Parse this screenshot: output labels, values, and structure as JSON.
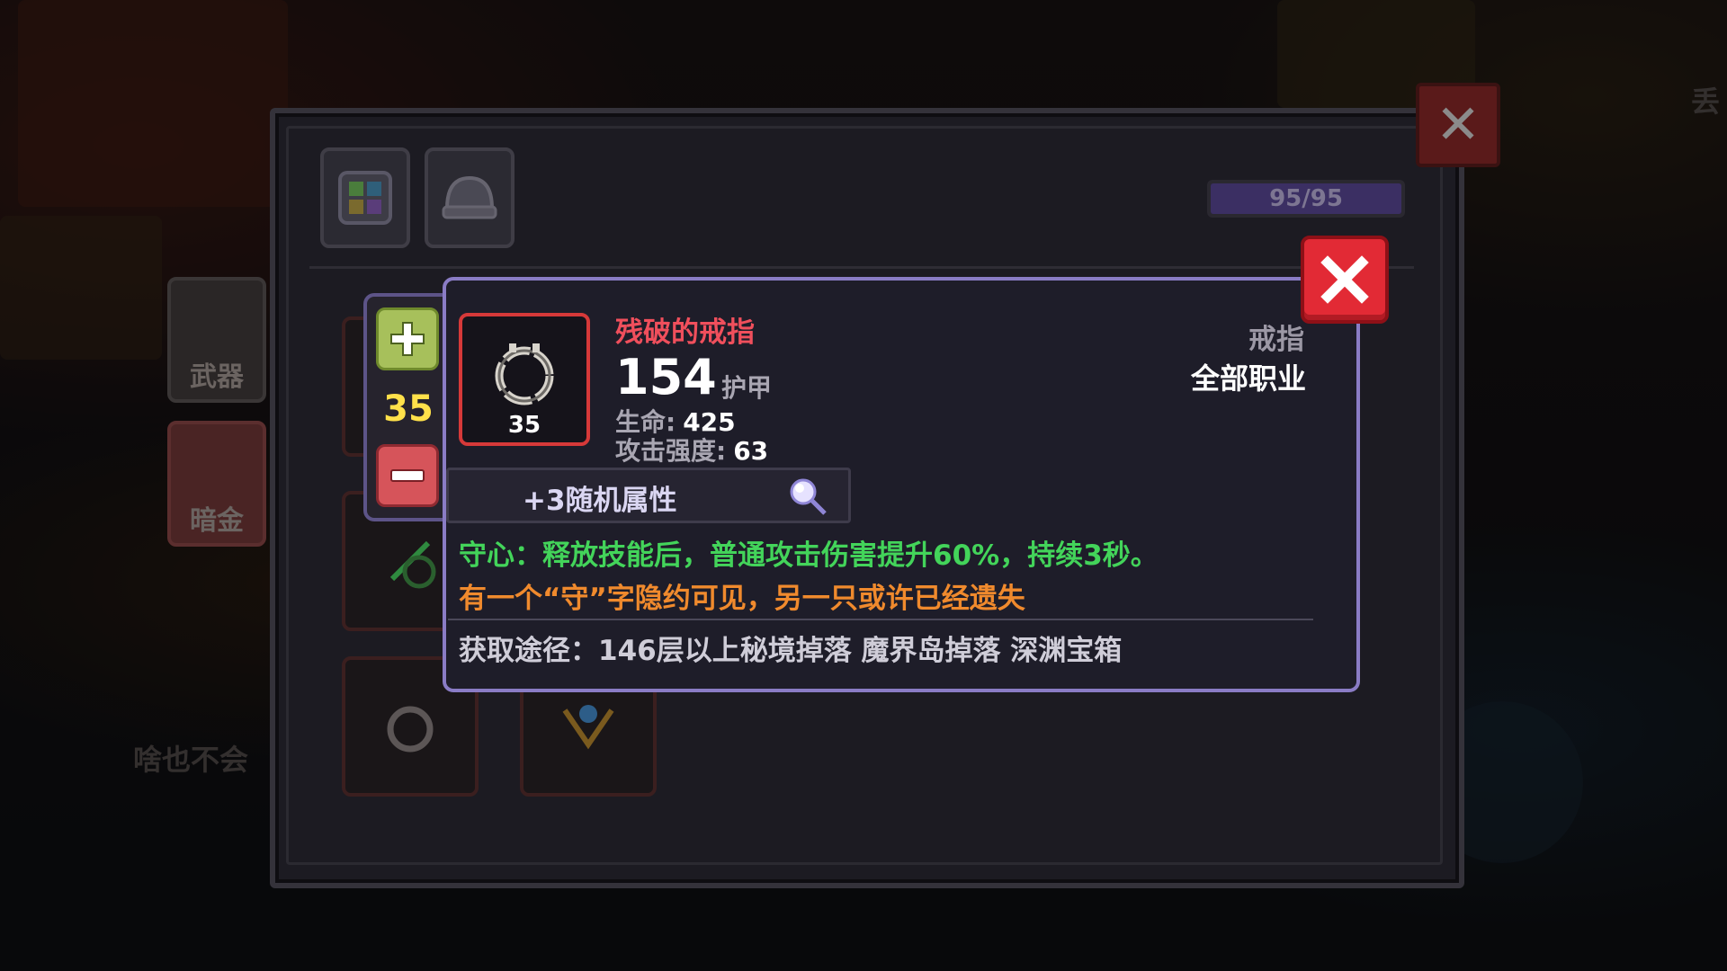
{
  "background": {
    "side_tabs": [
      {
        "label": "武器"
      },
      {
        "label": "暗金"
      }
    ],
    "npc_caption": "啥也不会",
    "right_edge_text": "丢"
  },
  "bag_panel": {
    "tabs": [
      {
        "icon": "grid-icon"
      },
      {
        "icon": "helmet-icon"
      }
    ],
    "capacity": {
      "text": "95/95",
      "fill_fraction": 1.0
    },
    "close_icon": "close-icon"
  },
  "stepper": {
    "plus_icon": "plus-icon",
    "value": "35",
    "minus_icon": "minus-icon"
  },
  "tooltip": {
    "item": {
      "name": "残破的戒指",
      "level": "35",
      "armor_value": "154",
      "armor_label": "护甲",
      "stats": [
        {
          "label": "生命:",
          "value": "425"
        },
        {
          "label": "攻击强度:",
          "value": "63"
        }
      ],
      "type": "戒指",
      "class": "全部职业"
    },
    "random_attributes": "+3随机属性",
    "effect": "守心：释放技能后，普通攻击伤害提升60%，持续3秒。",
    "flavor": "有一个“守”字隐约可见，另一只或许已经遗失",
    "source": "获取途径：146层以上秘境掉落 魔界岛掉落 深渊宝箱",
    "colors": {
      "name": "#f04f5c",
      "effect": "#43d45a",
      "flavor": "#f08a2d",
      "level_value": "#ffe14a",
      "border": "#8a7cc5",
      "close_button": "#e22a35"
    }
  }
}
